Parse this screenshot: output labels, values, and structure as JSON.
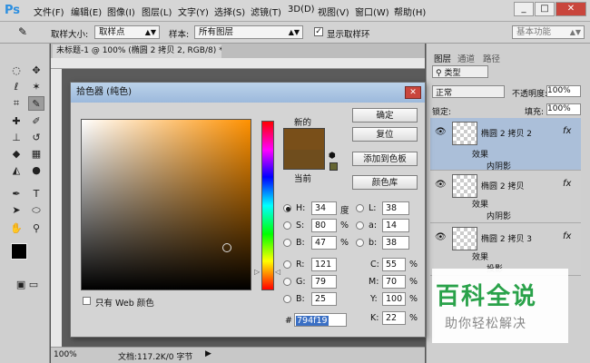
{
  "app": {
    "logo": "Ps"
  },
  "menu": [
    "文件(F)",
    "编辑(E)",
    "图像(I)",
    "图层(L)",
    "文字(Y)",
    "选择(S)",
    "滤镜(T)",
    "3D(D)",
    "视图(V)",
    "窗口(W)",
    "帮助(H)"
  ],
  "window_buttons": [
    "_",
    "□",
    "✕"
  ],
  "options_bar": {
    "sample_size_label": "取样大小:",
    "sample_size_value": "取样点",
    "sample_label": "样本:",
    "sample_value": "所有图层",
    "show_ring_label": "显示取样环",
    "workspace": "基本功能"
  },
  "document": {
    "tab_title": "未标题-1 @ 100% (椭圆 2 拷贝 2, RGB/8) *",
    "zoom": "100%",
    "doc_info": "文档:117.2K/0 字节"
  },
  "panels": {
    "tabs": [
      "图层",
      "通道",
      "路径"
    ],
    "filter_kind": "类型",
    "blend_mode": "正常",
    "opacity_label": "不透明度:",
    "opacity_value": "100%",
    "lock_label": "锁定:",
    "fill_label": "填充:",
    "fill_value": "100%",
    "layers": [
      {
        "name": "椭圆 2 拷贝 2",
        "fx": "fx",
        "effects_label": "效果",
        "effect": "内阴影",
        "selected": true
      },
      {
        "name": "椭圆 2 拷贝",
        "fx": "fx",
        "effects_label": "效果",
        "effect": "内阴影",
        "selected": false
      },
      {
        "name": "椭圆 2 拷贝 3",
        "fx": "fx",
        "effects_label": "效果",
        "effect": "投影",
        "selected": false
      }
    ]
  },
  "dialog": {
    "title": "拾色器 (纯色)",
    "new_label": "新的",
    "current_label": "当前",
    "new_color": "#794f19",
    "current_color": "#6f4d1d",
    "buttons": {
      "ok": "确定",
      "reset": "复位",
      "add_swatches": "添加到色板",
      "libraries": "颜色库"
    },
    "web_only_label": "只有 Web 颜色",
    "fields": {
      "H": {
        "label": "H:",
        "value": "34",
        "unit": "度"
      },
      "S": {
        "label": "S:",
        "value": "80",
        "unit": "%"
      },
      "B": {
        "label": "B:",
        "value": "47",
        "unit": "%"
      },
      "R": {
        "label": "R:",
        "value": "121"
      },
      "G": {
        "label": "G:",
        "value": "79"
      },
      "Bb": {
        "label": "B:",
        "value": "25"
      },
      "L": {
        "label": "L:",
        "value": "38"
      },
      "a": {
        "label": "a:",
        "value": "14"
      },
      "b": {
        "label": "b:",
        "value": "38"
      },
      "C": {
        "label": "C:",
        "value": "55",
        "unit": "%"
      },
      "M": {
        "label": "M:",
        "value": "70",
        "unit": "%"
      },
      "Y": {
        "label": "Y:",
        "value": "100",
        "unit": "%"
      },
      "K": {
        "label": "K:",
        "value": "22",
        "unit": "%"
      }
    },
    "hex_label": "#",
    "hex_value": "794f19"
  },
  "watermark": {
    "title": "百科全说",
    "subtitle": "助你轻松解决"
  }
}
